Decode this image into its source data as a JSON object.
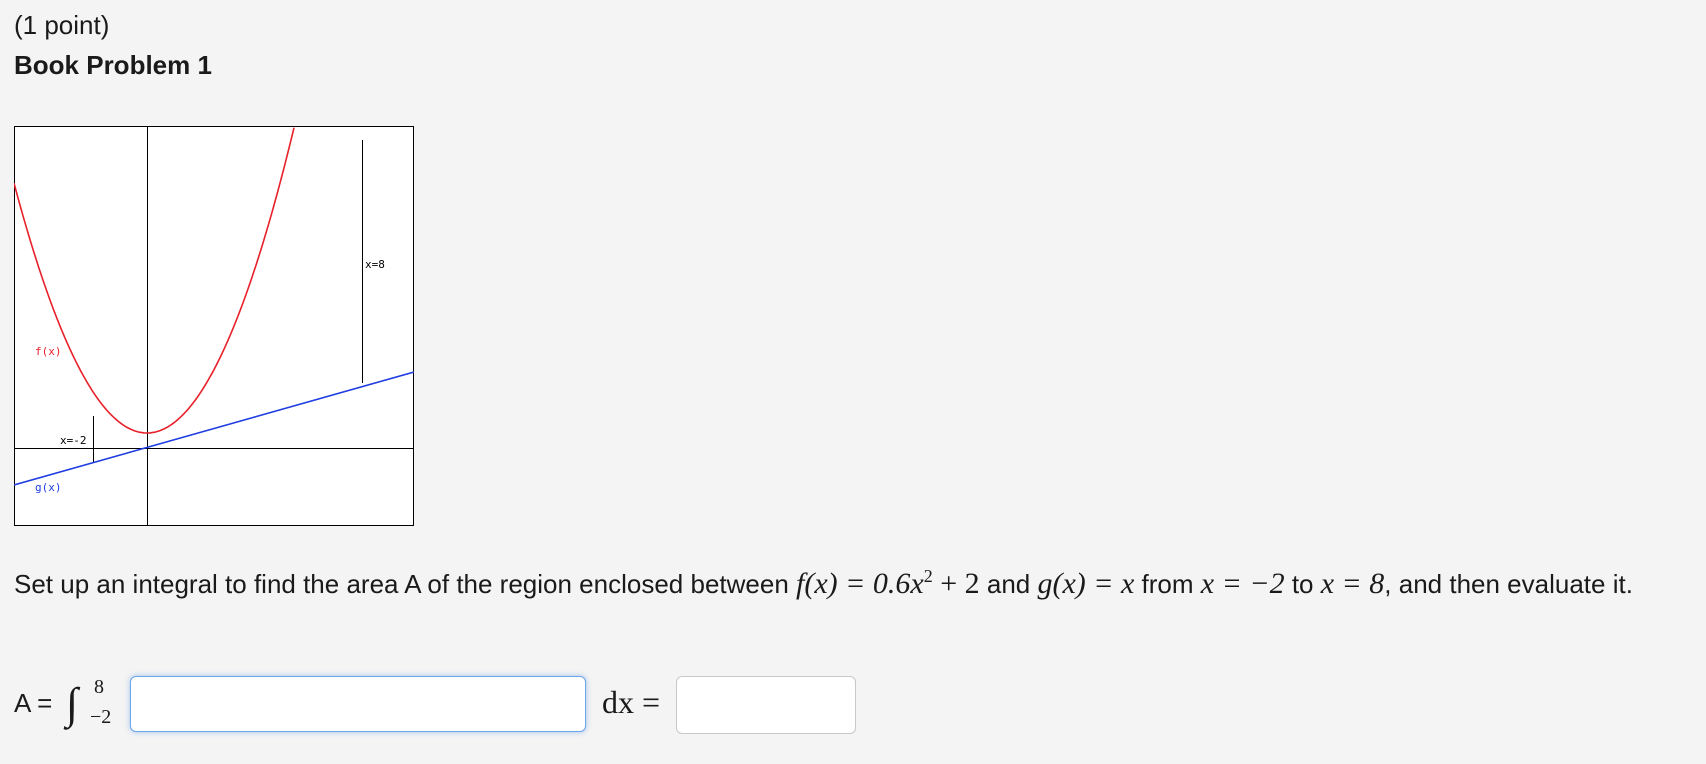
{
  "header": {
    "points": "(1 point)",
    "title": "Book Problem 1"
  },
  "graph": {
    "label_f": "f(x)",
    "label_g": "g(x)",
    "label_left_bound": "x=-2",
    "label_right_bound": "x=8",
    "colors": {
      "f": "#e8202a",
      "g": "#1f3de0",
      "axes": "#000000"
    }
  },
  "question": {
    "text_before": "Set up an integral to find the area A of the region enclosed between ",
    "f_def": "f(x) = 0.6x",
    "f_exp": "2",
    "f_rest": " + 2",
    "and_text": " and ",
    "g_def": "g(x) = x",
    "from_text": " from ",
    "x_lower": "x = −2",
    "to_text": " to ",
    "x_upper": "x = 8",
    "text_after": ", and then evaluate it."
  },
  "answer": {
    "a_label": "A =",
    "integral_sign": "∫",
    "upper_limit": "8",
    "lower_limit": "−2",
    "integrand_value": "",
    "differential": "dx =",
    "result_value": ""
  }
}
